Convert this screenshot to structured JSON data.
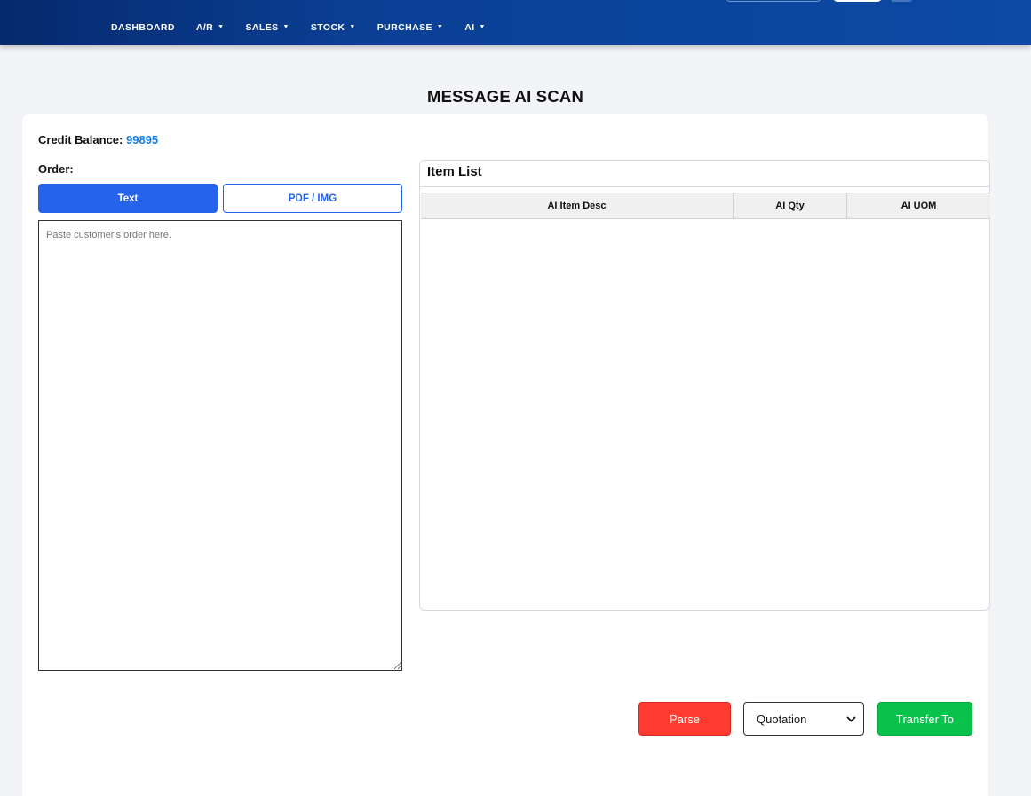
{
  "nav": {
    "items": [
      {
        "label": "DASHBOARD",
        "dropdown": false
      },
      {
        "label": "A/R",
        "dropdown": true
      },
      {
        "label": "SALES",
        "dropdown": true
      },
      {
        "label": "STOCK",
        "dropdown": true
      },
      {
        "label": "PURCHASE",
        "dropdown": true
      },
      {
        "label": "AI",
        "dropdown": true
      }
    ],
    "caret": "▼"
  },
  "page": {
    "title": "MESSAGE AI SCAN"
  },
  "credit": {
    "label": "Credit Balance:",
    "value": "99895"
  },
  "order": {
    "label": "Order:",
    "tabs": {
      "text": "Text",
      "pdf": "PDF / IMG"
    },
    "placeholder": "Paste customer's order here.",
    "value": ""
  },
  "item_list": {
    "title": "Item List",
    "columns": [
      "AI Item Desc",
      "AI Qty",
      "AI UOM"
    ],
    "rows": []
  },
  "actions": {
    "parse_label": "Parse",
    "transfer_select": {
      "selected": "Quotation",
      "chevron": "⌄"
    },
    "transfer_label": "Transfer To"
  },
  "colors": {
    "primary": "#2563eb",
    "credit_value": "#1a7fe0",
    "parse": "#ff3b30",
    "transfer": "#08c24b",
    "topbar": "#0a3f94"
  }
}
